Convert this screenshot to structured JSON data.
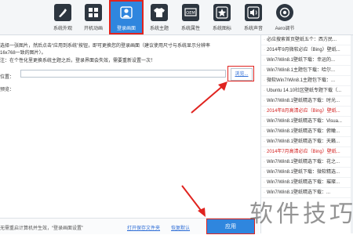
{
  "toolbar": {
    "items": [
      {
        "label": "系统外观",
        "icon": "palette-icon"
      },
      {
        "label": "开机动画",
        "icon": "windows-flag-icon"
      },
      {
        "label": "登录画面",
        "icon": "user-login-icon",
        "active": true
      },
      {
        "label": "系统主题",
        "icon": "tshirt-icon"
      },
      {
        "label": "系统属性",
        "icon": "oem-icon"
      },
      {
        "label": "系统图标",
        "icon": "star-icon"
      },
      {
        "label": "系统声音",
        "icon": "speaker-icon"
      },
      {
        "label": "Aero调节",
        "icon": "aero-icon"
      }
    ]
  },
  "main": {
    "desc_line1": "选择一张图片，然后点击“应用到系统”按钮，即可更换您的登录画面（建议使用尺寸与系统显示分辨率",
    "desc_line2": "16x768一致的图片）。",
    "desc_line3": "注：在个性化里更换系统主题之后，登录界面会失效，需要重新设置一次！",
    "path_label": "位置：",
    "path_value": "",
    "browse_label": "浏览...",
    "preview_label": "预览：",
    "bottom_note": "无需重启计算机并生效，“登录画面设置”",
    "open_save_label": "打开保存文件夹",
    "reset_default_label": "恢复默认",
    "apply_label": "应用"
  },
  "sidebar": {
    "items": [
      {
        "text": "必应搜索首页壁纸五个：西方民...",
        "red": false
      },
      {
        "text": "2014年9月微软必应（Bing）壁纸...",
        "red": false
      },
      {
        "text": "Win7/Win8.1壁纸下载：幸运的...",
        "red": false
      },
      {
        "text": "Win7/Win8.1主题包下载：哈尔...",
        "red": false
      },
      {
        "text": "微软Win7/Win8.1主题包下载：...",
        "red": false
      },
      {
        "text": "Ubuntu 14.10社区壁纸专题下载（...",
        "red": false
      },
      {
        "text": "Win7/Win8.1壁纸精选下载：时光...",
        "red": false
      },
      {
        "text": "2014年8月高清必应（Bing）壁纸...",
        "red": true
      },
      {
        "text": "Win7/Win8.1壁纸精选下载：Visua...",
        "red": false
      },
      {
        "text": "Win7/Win8.1壁纸精选下载：俯瞰...",
        "red": false
      },
      {
        "text": "Win7/Win8.1壁纸精选下载：天籁...",
        "red": false
      },
      {
        "text": "2014年7月高清必应（Bing）壁纸...",
        "red": true
      },
      {
        "text": "Win7/Win8.1壁纸精选下载：花之...",
        "red": false
      },
      {
        "text": "Win7/Win8.1壁纸下载：微软精选...",
        "red": false
      },
      {
        "text": "Win7/Win8.1壁纸精选下载：璀璨...",
        "red": false
      },
      {
        "text": "Win7/Win8.1壁纸精选下载：...",
        "red": false
      }
    ]
  },
  "watermark": "软件技巧",
  "colors": {
    "accent": "#2f86de",
    "highlight": "#e0231f",
    "news_red": "#d32020"
  }
}
